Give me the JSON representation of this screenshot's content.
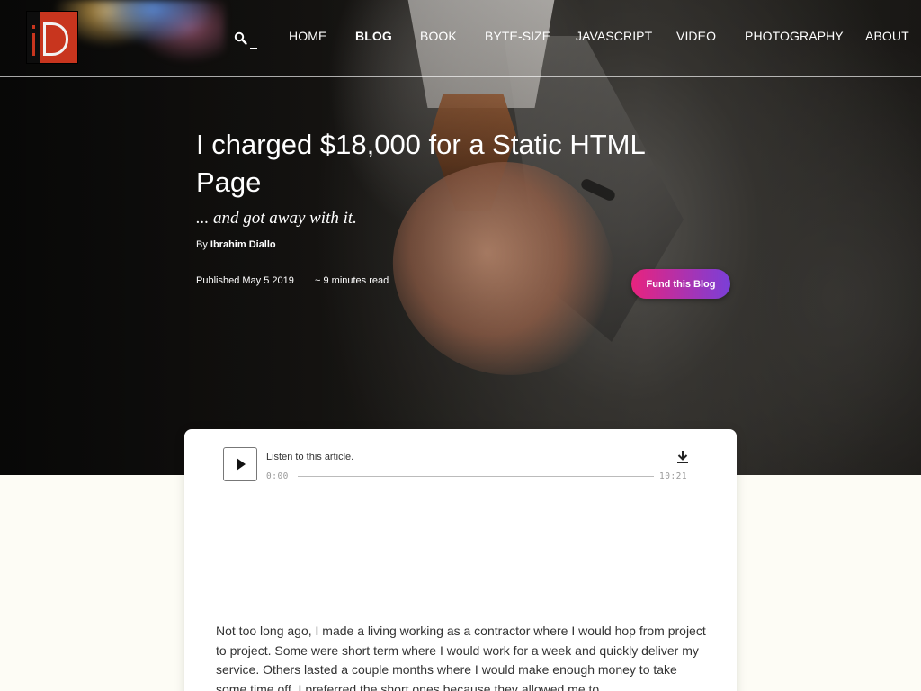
{
  "header": {
    "logo_alt": "iD",
    "search_icon": "search-icon",
    "nav": [
      {
        "label": "HOME",
        "active": false
      },
      {
        "label": "BLOG",
        "active": true
      },
      {
        "label": "BOOK",
        "active": false
      },
      {
        "label": "BYTE-SIZE",
        "active": false
      },
      {
        "label": "JAVASCRIPT",
        "active": false
      },
      {
        "label": "VIDEO",
        "active": false
      },
      {
        "label": "PHOTOGRAPHY",
        "active": false
      },
      {
        "label": "ABOUT",
        "active": false
      }
    ]
  },
  "post": {
    "title": "I charged $18,000 for a Static HTML Page",
    "subtitle": "... and got away with it.",
    "byline_prefix": "By",
    "author": "Ibrahim Diallo",
    "published": "Published May 5 2019",
    "read_time": "~ 9 minutes read",
    "fund_button": "Fund this Blog"
  },
  "player": {
    "label": "Listen to this article.",
    "current_time": "0:00",
    "duration": "10:21",
    "progress": 0,
    "play_icon": "play-icon",
    "download_icon": "download-icon"
  },
  "article": {
    "first_paragraph": "Not too long ago, I made a living working as a contractor where I would hop from project to project. Some were short term where I would work for a week and quickly deliver my service. Others lasted a couple months where I would make enough money to take some time off. I preferred the short ones because they allowed me to"
  },
  "colors": {
    "accent_gradient_start": "#e8237e",
    "accent_gradient_end": "#7a3fd8",
    "logo_red": "#c8351e",
    "page_background": "#fdfcf5"
  }
}
